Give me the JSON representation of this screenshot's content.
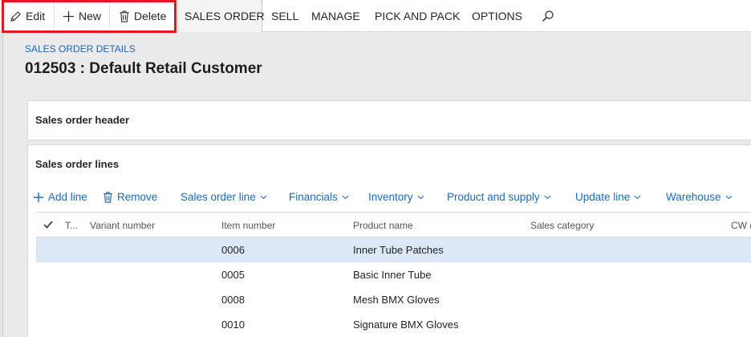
{
  "action_pane": {
    "edit_label": "Edit",
    "new_label": "New",
    "delete_label": "Delete",
    "tabs": [
      "SALES ORDER",
      "SELL",
      "MANAGE",
      "PICK AND PACK",
      "OPTIONS"
    ]
  },
  "page": {
    "breadcrumb": "SALES ORDER DETAILS",
    "title": "012503 : Default Retail Customer"
  },
  "sections": {
    "header_title": "Sales order header",
    "lines_title": "Sales order lines"
  },
  "lines_toolbar": {
    "add_line": "Add line",
    "remove": "Remove",
    "menus": [
      "Sales order line",
      "Financials",
      "Inventory",
      "Product and supply",
      "Update line",
      "Warehouse"
    ]
  },
  "grid": {
    "columns": [
      "T...",
      "Variant number",
      "Item number",
      "Product name",
      "Sales category",
      "CW q"
    ],
    "rows": [
      {
        "item_number": "0006",
        "product_name": "Inner Tube Patches"
      },
      {
        "item_number": "0005",
        "product_name": "Basic Inner Tube"
      },
      {
        "item_number": "0008",
        "product_name": "Mesh BMX Gloves"
      },
      {
        "item_number": "0010",
        "product_name": "Signature BMX Gloves"
      }
    ]
  },
  "colors": {
    "highlight": "#e3171d",
    "link_blue": "#1e68b8",
    "selected_row": "#dbe9f7"
  }
}
